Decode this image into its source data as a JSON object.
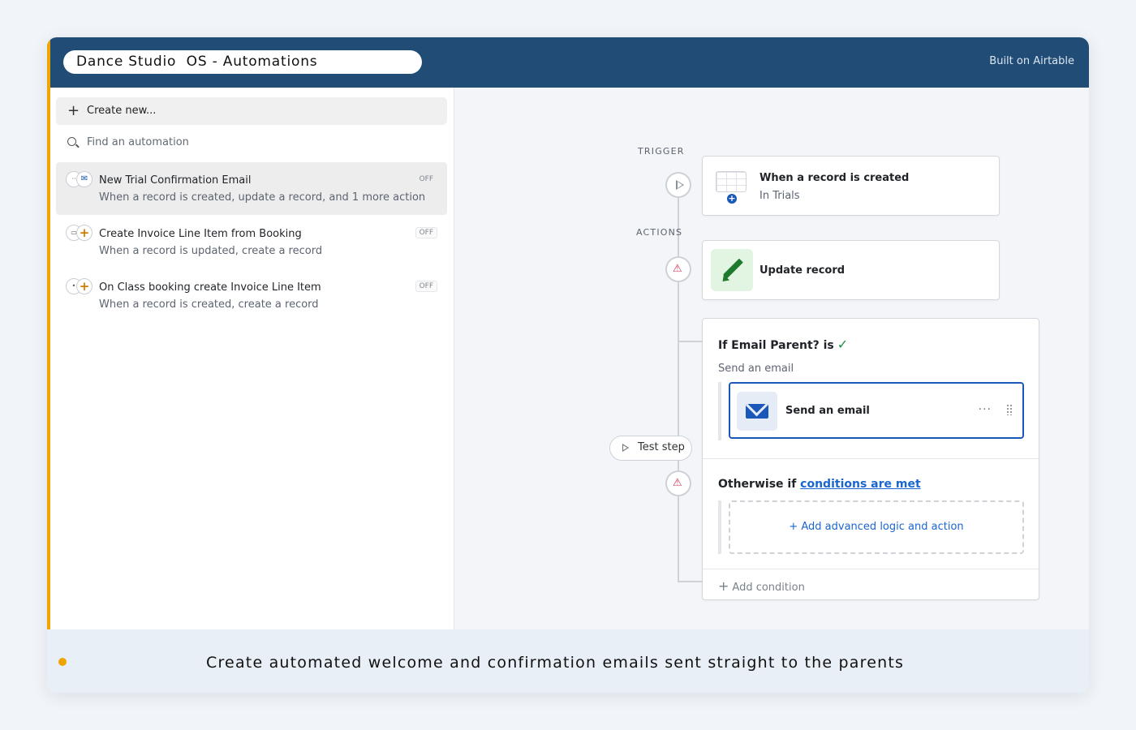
{
  "header": {
    "title": "Dance Studio  OS - Automations",
    "built_on": "Built on Airtable"
  },
  "sidebar": {
    "create_new": "Create new...",
    "search_placeholder": "Find an automation",
    "items": [
      {
        "name": "New Trial Confirmation Email",
        "description": "When a record is created, update a record, and 1 more action",
        "status": "OFF",
        "icons": [
          "dots-icon",
          "mail-icon"
        ]
      },
      {
        "name": "Create Invoice Line Item from Booking",
        "description": "When a record is updated, create a record",
        "status": "OFF",
        "icons": [
          "table-icon",
          "add-icon"
        ]
      },
      {
        "name": "On Class booking create Invoice Line Item",
        "description": "When a record is created, create a record",
        "status": "OFF",
        "icons": [
          "record-icon",
          "add-icon"
        ]
      }
    ]
  },
  "flow": {
    "trigger_label": "TRIGGER",
    "actions_label": "ACTIONS",
    "trigger": {
      "title": "When a record is created",
      "subtitle": "In Trials"
    },
    "update_step": {
      "title": "Update record"
    },
    "branch": {
      "if_text": "If Email Parent? is",
      "if_check": "✓",
      "sub_label": "Send an email",
      "email_step_title": "Send an email",
      "email_step_menu": "···",
      "otherwise_prefix": "Otherwise if",
      "otherwise_link": "conditions are met",
      "add_logic": "+ Add advanced logic and action",
      "add_condition": "Add condition",
      "add_condition_icon": "+"
    },
    "test_step": "Test step"
  },
  "footer": {
    "caption": "Create automated welcome and confirmation emails sent straight to the parents"
  },
  "colors": {
    "header_bg": "#204c75",
    "accent": "#f0a400",
    "link": "#1a66d1",
    "selected_border": "#1a57b8",
    "warning": "#d03050",
    "success": "#1a8f3a"
  }
}
